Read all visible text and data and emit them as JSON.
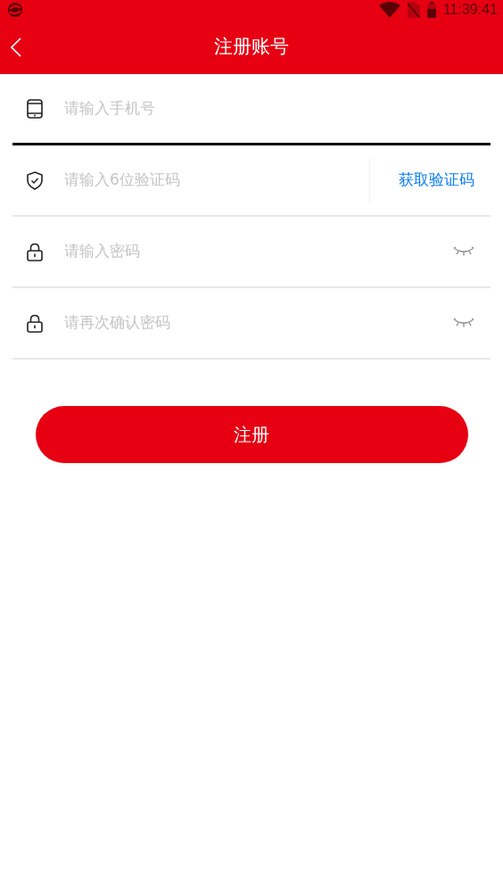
{
  "status_bar": {
    "time": "11:39:41"
  },
  "header": {
    "title": "注册账号"
  },
  "fields": [
    {
      "kind": "phone",
      "placeholder": "请输入手机号",
      "focused": true
    },
    {
      "kind": "code",
      "placeholder": "请输入6位验证码",
      "action": "获取验证码",
      "focused": false
    },
    {
      "kind": "password",
      "placeholder": "请输入密码",
      "focused": false
    },
    {
      "kind": "password",
      "placeholder": "请再次确认密码",
      "focused": false
    }
  ],
  "submit": {
    "label": "注册"
  }
}
